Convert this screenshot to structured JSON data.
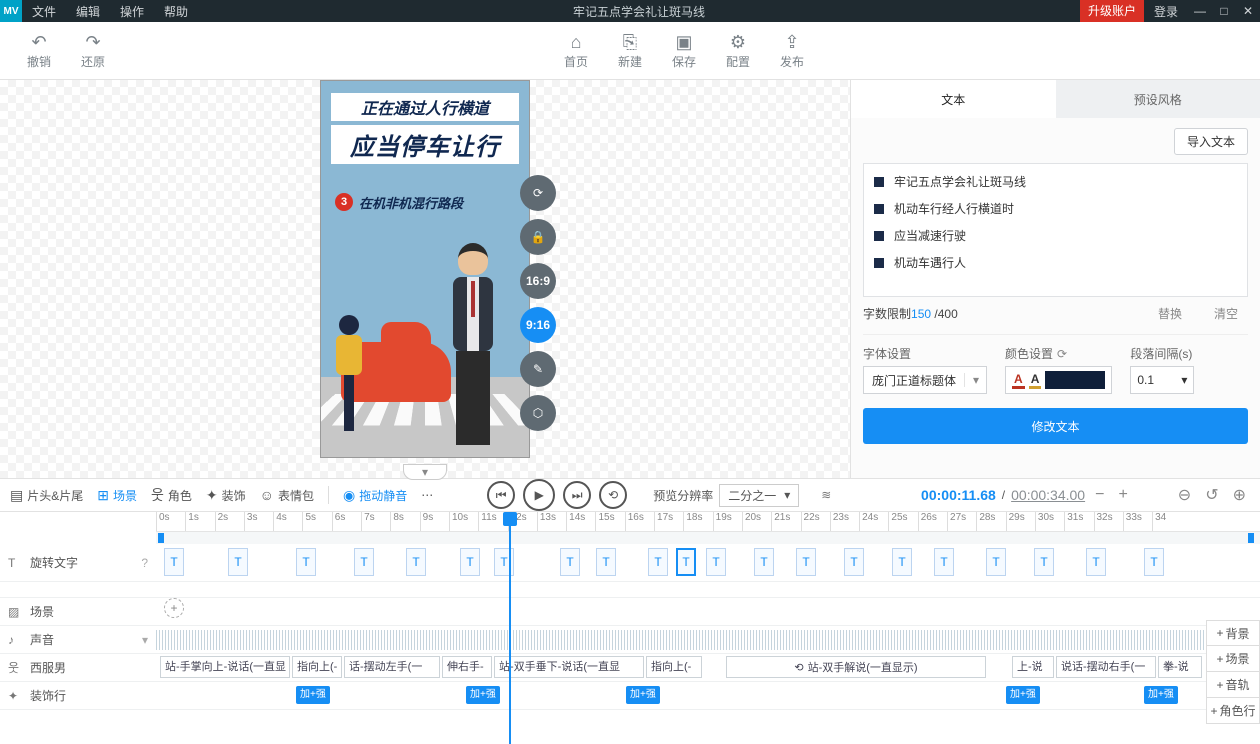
{
  "titlebar": {
    "logo": "MV",
    "menus": [
      "文件",
      "编辑",
      "操作",
      "帮助"
    ],
    "title": "牢记五点学会礼让斑马线",
    "upgrade": "升级账户",
    "login": "登录"
  },
  "toolbar": {
    "undo": "撤销",
    "redo": "还原",
    "home": "首页",
    "new": "新建",
    "save": "保存",
    "config": "配置",
    "publish": "发布"
  },
  "canvas": {
    "line1": "正在通过人行横道",
    "line2": "应当停车让行",
    "badge": "3",
    "line3": "在机非机混行路段",
    "ratios": {
      "r169": "16:9",
      "r916": "9:16"
    }
  },
  "rpanel": {
    "tabs": {
      "text": "文本",
      "preset": "预设风格"
    },
    "import": "导入文本",
    "items": [
      "牢记五点学会礼让斑马线",
      "机动车行经人行横道时",
      "应当减速行驶",
      "机动车遇行人"
    ],
    "limit_label": "字数限制",
    "limit_cur": "150",
    "limit_sep": " /400",
    "replace": "替换",
    "clear": "清空",
    "font_label": "字体设置",
    "font_value": "庞门正道标题体",
    "color_label": "颜色设置",
    "gap_label": "段落间隔(s)",
    "gap_value": "0.1",
    "modify": "修改文本"
  },
  "midbar": {
    "headtail": "片头&片尾",
    "scene": "场景",
    "role": "角色",
    "deco": "装饰",
    "emoji": "表情包",
    "dragmute": "拖动静音",
    "preview_label": "预览分辨率",
    "preview_value": "二分之一",
    "time_cur": "00:00:11.68",
    "time_sep": " / ",
    "time_total": "00:00:34.00"
  },
  "timeline": {
    "ticks": [
      "0s",
      "1s",
      "2s",
      "3s",
      "4s",
      "5s",
      "6s",
      "7s",
      "8s",
      "9s",
      "10s",
      "11s",
      "12s",
      "13s",
      "14s",
      "15s",
      "16s",
      "17s",
      "18s",
      "19s",
      "20s",
      "21s",
      "22s",
      "23s",
      "24s",
      "25s",
      "26s",
      "27s",
      "28s",
      "29s",
      "30s",
      "31s",
      "32s",
      "33s",
      "34"
    ],
    "tracks": {
      "text": "旋转文字",
      "scene": "场景",
      "audio": "声音",
      "char": "西服男",
      "deco": "装饰行"
    },
    "char_clips": [
      "站-手掌向上-说话(一直显",
      "指向上(-",
      "话-摆动左手(一",
      "伸右手-",
      "站-双手垂下-说话(一直显",
      "指向上(-",
      "上-说",
      "说话-摆动右手(一",
      "拳-说"
    ],
    "char_stand": "站-双手解说(一直显示)",
    "deco_label": "加+强",
    "rightadd": [
      "背景",
      "场景",
      "音轨",
      "角色行"
    ]
  }
}
